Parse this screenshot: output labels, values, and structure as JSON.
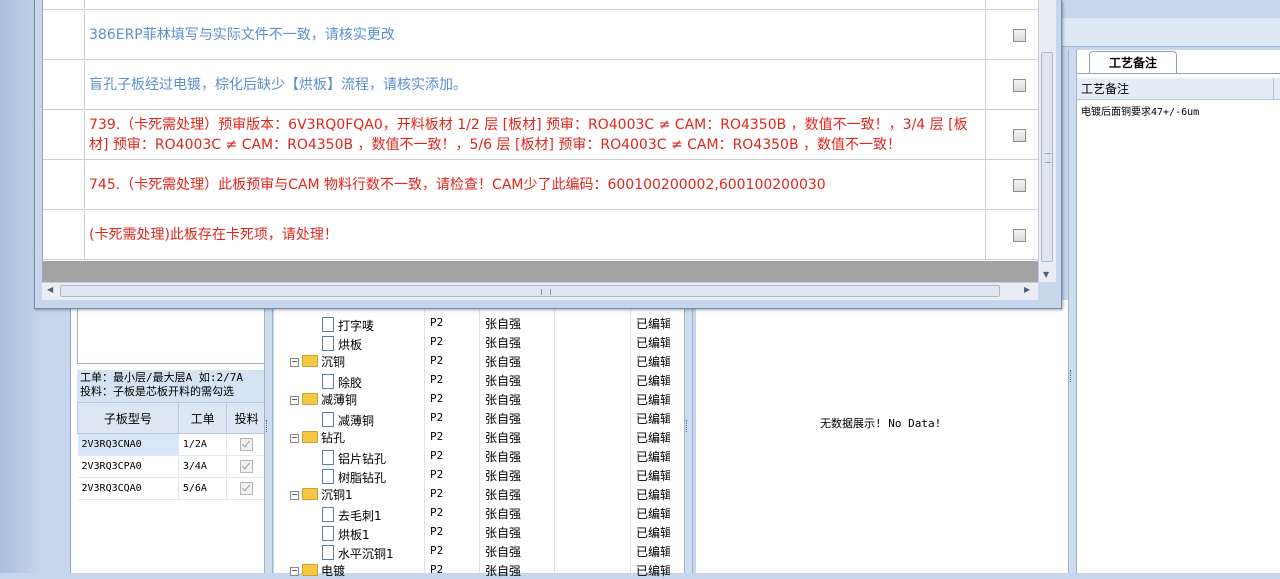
{
  "dialog": {
    "rows": [
      {
        "text": "",
        "color": "blue",
        "checked": false
      },
      {
        "text": "386ERP菲林填写与实际文件不一致，请核实更改",
        "color": "blue",
        "checked": false
      },
      {
        "text": "盲孔子板经过电镀，棕化后缺少【烘板】流程，请核实添加。",
        "color": "blue",
        "checked": false
      },
      {
        "text": "739.（卡死需处理）预审版本：6V3RQ0FQA0，开料板材 1/2 层 [板材] 预审：RO4003C ≠ CAM：RO4350B ，数值不一致！，3/4 层 [板材] 预审：RO4003C ≠ CAM：RO4350B ，数值不一致！，5/6 层 [板材] 预审：RO4003C ≠ CAM：RO4350B ，数值不一致！",
        "color": "red",
        "checked": false
      },
      {
        "text": "745.（卡死需处理）此板预审与CAM 物料行数不一致，请检查！CAM少了此编码：600100200002,600100200030",
        "color": "red",
        "checked": false
      },
      {
        "text": "(卡死需处理)此板存在卡死项，请处理！",
        "color": "red",
        "checked": false
      }
    ]
  },
  "left_panel": {
    "note_line1": "工单：最小层/最大层A 如:2/7A",
    "note_line2": "投料：子板是芯板开料的需勾选",
    "headers": [
      "子板型号",
      "工单",
      "投料"
    ],
    "rows": [
      {
        "model": "2V3RQ3CNA0",
        "order": "1/2A",
        "feed": true
      },
      {
        "model": "2V3RQ3CPA0",
        "order": "3/4A",
        "feed": true
      },
      {
        "model": "2V3RQ3CQA0",
        "order": "5/6A",
        "feed": true
      }
    ]
  },
  "tree": {
    "rows": [
      {
        "name": "打字唛",
        "level": 2,
        "kind": "doc",
        "code": "P2",
        "person": "张自强",
        "status": "已编辑"
      },
      {
        "name": "烘板",
        "level": 2,
        "kind": "doc",
        "code": "P2",
        "person": "张自强",
        "status": "已编辑"
      },
      {
        "name": "沉铜",
        "level": 1,
        "kind": "folder",
        "code": "P2",
        "person": "张自强",
        "status": "已编辑"
      },
      {
        "name": "除胶",
        "level": 2,
        "kind": "doc",
        "code": "P2",
        "person": "张自强",
        "status": "已编辑"
      },
      {
        "name": "减薄铜",
        "level": 1,
        "kind": "folder",
        "code": "P2",
        "person": "张自强",
        "status": "已编辑"
      },
      {
        "name": "减薄铜",
        "level": 2,
        "kind": "doc",
        "code": "P2",
        "person": "张自强",
        "status": "已编辑"
      },
      {
        "name": "钻孔",
        "level": 1,
        "kind": "folder",
        "code": "P2",
        "person": "张自强",
        "status": "已编辑"
      },
      {
        "name": "铝片钻孔",
        "level": 2,
        "kind": "doc",
        "code": "P2",
        "person": "张自强",
        "status": "已编辑"
      },
      {
        "name": "树脂钻孔",
        "level": 2,
        "kind": "doc",
        "code": "P2",
        "person": "张自强",
        "status": "已编辑"
      },
      {
        "name": "沉铜1",
        "level": 1,
        "kind": "folder",
        "code": "P2",
        "person": "张自强",
        "status": "已编辑"
      },
      {
        "name": "去毛刺1",
        "level": 2,
        "kind": "doc",
        "code": "P2",
        "person": "张自强",
        "status": "已编辑"
      },
      {
        "name": "烘板1",
        "level": 2,
        "kind": "doc",
        "code": "P2",
        "person": "张自强",
        "status": "已编辑"
      },
      {
        "name": "水平沉铜1",
        "level": 2,
        "kind": "doc",
        "code": "P2",
        "person": "张自强",
        "status": "已编辑"
      },
      {
        "name": "电镀",
        "level": 1,
        "kind": "folder",
        "code": "P2",
        "person": "张自强",
        "status": "已编辑"
      }
    ]
  },
  "nodata_text": "无数据展示! No Data!",
  "right_panel": {
    "tab_label": "工艺备注",
    "column_header": "工艺备注",
    "value": "电镀后面铜要求47+/-6um"
  }
}
